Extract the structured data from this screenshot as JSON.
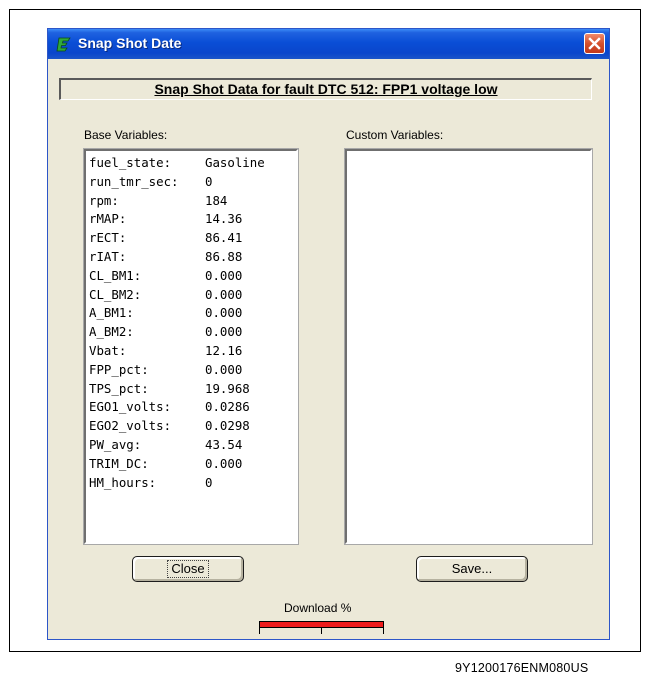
{
  "window": {
    "title": "Snap Shot Date"
  },
  "banner": {
    "text": "Snap Shot Data for fault DTC 512: FPP1 voltage low"
  },
  "base_variables": {
    "label": "Base Variables:",
    "items": [
      {
        "name": "fuel_state:",
        "value": "Gasoline"
      },
      {
        "name": "run_tmr_sec:",
        "value": "0"
      },
      {
        "name": "rpm:",
        "value": "184"
      },
      {
        "name": "rMAP:",
        "value": "14.36"
      },
      {
        "name": "rECT:",
        "value": "86.41"
      },
      {
        "name": "rIAT:",
        "value": "86.88"
      },
      {
        "name": "CL_BM1:",
        "value": "0.000"
      },
      {
        "name": "CL_BM2:",
        "value": "0.000"
      },
      {
        "name": "A_BM1:",
        "value": "0.000"
      },
      {
        "name": "A_BM2:",
        "value": "0.000"
      },
      {
        "name": "Vbat:",
        "value": "12.16"
      },
      {
        "name": "FPP_pct:",
        "value": "0.000"
      },
      {
        "name": "TPS_pct:",
        "value": "19.968"
      },
      {
        "name": "EGO1_volts:",
        "value": "0.0286"
      },
      {
        "name": "EGO2_volts:",
        "value": "0.0298"
      },
      {
        "name": "PW_avg:",
        "value": "43.54"
      },
      {
        "name": "TRIM_DC:",
        "value": "0.000"
      },
      {
        "name": "HM_hours:",
        "value": "0"
      }
    ]
  },
  "custom_variables": {
    "label": "Custom Variables:",
    "items": []
  },
  "buttons": {
    "close": "Close",
    "save": "Save..."
  },
  "download": {
    "label": "Download %",
    "progress_percent": 100,
    "bar_color": "#ee1c1c"
  },
  "document_id": "9Y1200176ENM080US",
  "colors": {
    "titlebar": "#0a4ed6",
    "dialog_bg": "#ece9d8",
    "close_button": "#d4512d"
  }
}
